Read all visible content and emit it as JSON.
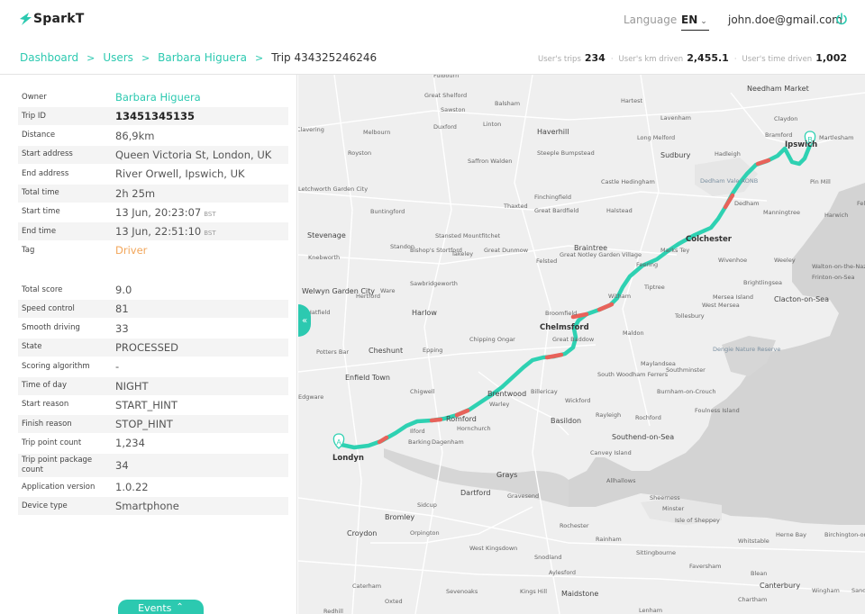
{
  "app": {
    "name": "SparkT"
  },
  "header": {
    "language_label": "Language",
    "language_value": "EN",
    "user_email": "john.doe@gmail.com"
  },
  "breadcrumb": [
    "Dashboard",
    "Users",
    "Barbara Higuera",
    "Trip 434325246246"
  ],
  "stats": [
    {
      "label": "User's trips",
      "value": "234"
    },
    {
      "label": "User's km driven",
      "value": "2,455.1"
    },
    {
      "label": "User's time driven",
      "value": "1,002"
    }
  ],
  "trip_info": [
    {
      "label": "Owner",
      "value": "Barbara Higuera",
      "style": "link"
    },
    {
      "label": "Trip ID",
      "value": "13451345135",
      "style": "bold"
    },
    {
      "label": "Distance",
      "value": "86,9km"
    },
    {
      "label": "Start address",
      "value": "Queen Victoria St, London, UK"
    },
    {
      "label": "End address",
      "value": "River Orwell, Ipswich, UK"
    },
    {
      "label": "Total time",
      "value": "2h 25m"
    },
    {
      "label": "Start time",
      "value": "13 Jun, 20:23:07",
      "tz": "BST"
    },
    {
      "label": "End time",
      "value": "13 Jun, 22:51:10",
      "tz": "BST"
    },
    {
      "label": "Tag",
      "value": "Driver",
      "style": "tag"
    }
  ],
  "trip_scores": [
    {
      "label": "Total score",
      "value": "9.0"
    },
    {
      "label": "Speed control",
      "value": "81"
    },
    {
      "label": "Smooth driving",
      "value": "33"
    },
    {
      "label": "State",
      "value": "PROCESSED"
    },
    {
      "label": "Scoring algorithm",
      "value": "-"
    },
    {
      "label": "Time of day",
      "value": "NIGHT"
    },
    {
      "label": "Start reason",
      "value": "START_HINT"
    },
    {
      "label": "Finish reason",
      "value": "STOP_HINT"
    },
    {
      "label": "Trip point count",
      "value": "1,234"
    },
    {
      "label": "Trip point package count",
      "value": "34"
    },
    {
      "label": "Application version",
      "value": "1.0.22"
    },
    {
      "label": "Device type",
      "value": "Smartphone"
    }
  ],
  "events_button": "Events",
  "map": {
    "start_marker": "A",
    "end_marker": "B",
    "route_color": "#2ed1b2",
    "speeding_color": "#e8625a",
    "places": [
      "Fulbourn",
      "Great Shelford",
      "Balsham",
      "Hartest",
      "Needham Market",
      "Sawston",
      "Clavering",
      "Linton",
      "Lavenham",
      "Claydon",
      "Duxford",
      "Haverhill",
      "Long Melford",
      "Bramford",
      "Martlesham",
      "Melbourn",
      "Steeple Bumpstead",
      "Sudbury",
      "Hadleigh",
      "Ipswich",
      "Royston",
      "Saffron Walden",
      "Castle Hedingham",
      "Finchingfield",
      "Dedham Vale AONB",
      "Pin Mill",
      "Letchworth Garden City",
      "Buntingford",
      "Thaxted",
      "Great Bardfield",
      "Halstead",
      "Dedham",
      "Manningtree",
      "Harwich",
      "Felixstowe",
      "Stevenage",
      "Stansted Mountfitchet",
      "Colchester",
      "Standon",
      "Bishop's Stortford",
      "Takeley",
      "Great Dunmow",
      "Braintree",
      "Felsted",
      "Great Notley Garden Village",
      "Marks Tey",
      "Wivenhoe",
      "Weeley",
      "Walton-on-the-Naze",
      "Knebworth",
      "Frinton-on-Sea",
      "Feering",
      "Brightlingsea",
      "Welwyn Garden City",
      "Hertford",
      "Ware",
      "Sawbridgeworth",
      "Witham",
      "Tiptree",
      "Mersea Island",
      "West Mersea",
      "Clacton-on-Sea",
      "Hatfield",
      "Harlow",
      "Broomfield",
      "Tollesbury",
      "Chelmsford",
      "Great Baddow",
      "Maldon",
      "Potters Bar",
      "Cheshunt",
      "Epping",
      "Chipping Ongar",
      "Dengie Nature Reserve",
      "Enfield Town",
      "Maylandsea",
      "Southminster",
      "South Woodham Ferrers",
      "Chigwell",
      "Brentwood",
      "Billericay",
      "Wickford",
      "Burnham-on-Crouch",
      "Edgware",
      "Warley",
      "Foulness Island",
      "Rayleigh",
      "Rochford",
      "Romford",
      "Hornchurch",
      "Basildon",
      "Ilford",
      "Barking",
      "Dagenham",
      "Southend-on-Sea",
      "Londyn",
      "Canvey Island",
      "Grays",
      "Allhallows",
      "Dartford",
      "Gravesend",
      "Sheerness",
      "Minster",
      "Sidcup",
      "Isle of Sheppey",
      "Bromley",
      "Rochester",
      "Whitstable",
      "Herne Bay",
      "Birchington-on-Sea",
      "Croydon",
      "Orpington",
      "Rainham",
      "West Kingsdown",
      "Sittingbourne",
      "Snodland",
      "Faversham",
      "Aylesford",
      "Blean",
      "Caterham",
      "Sevenoaks",
      "Kings Hill",
      "Maidstone",
      "Canterbury",
      "Wingham",
      "Sandwich",
      "Oxted",
      "Redhill",
      "Lenham",
      "Chartham"
    ]
  }
}
